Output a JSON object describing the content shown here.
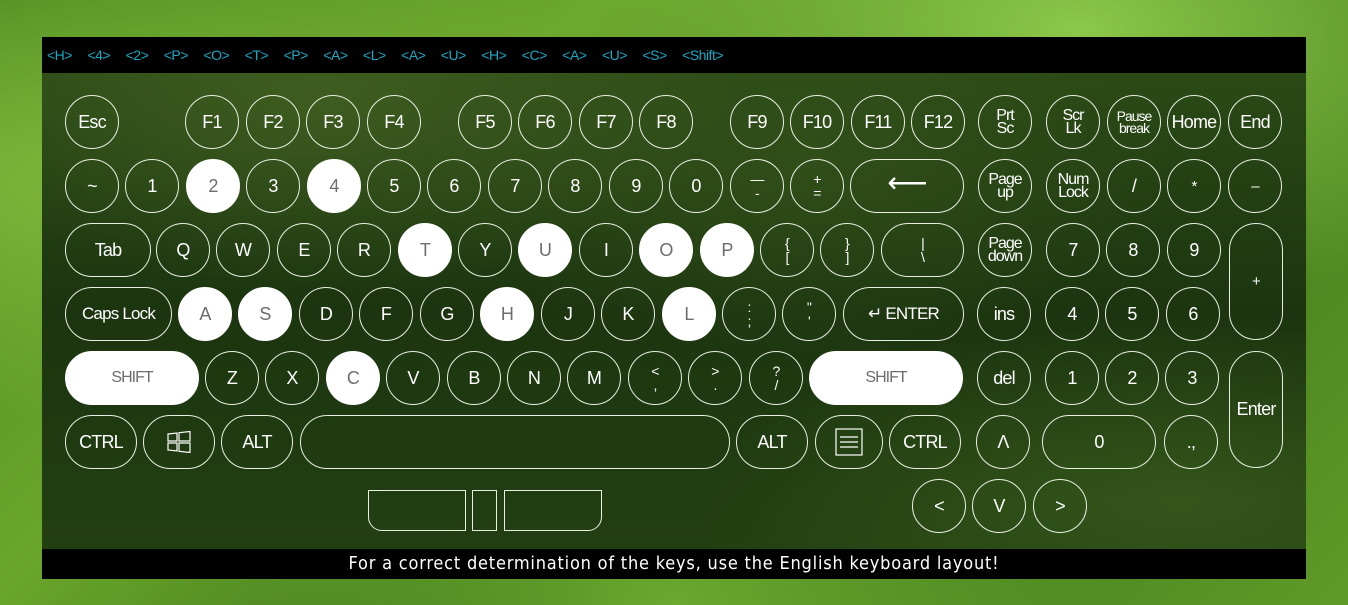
{
  "sequence": [
    "<H>",
    "<4>",
    "<2>",
    "<P>",
    "<O>",
    "<T>",
    "<P>",
    "<A>",
    "<L>",
    "<A>",
    "<U>",
    "<H>",
    "<C>",
    "<A>",
    "<U>",
    "<S>",
    "<Shift>"
  ],
  "footer_message": "For a correct determination of the keys, use the English keyboard layout!",
  "highlight_color": "#ffffff",
  "sequence_color": "#19a9c4",
  "keys": {
    "esc": "Esc",
    "f1": "F1",
    "f2": "F2",
    "f3": "F3",
    "f4": "F4",
    "f5": "F5",
    "f6": "F6",
    "f7": "F7",
    "f8": "F8",
    "f9": "F9",
    "f10": "F10",
    "f11": "F11",
    "f12": "F12",
    "prtsc": [
      "Prt",
      "Sc"
    ],
    "scrlk": [
      "Scr",
      "Lk"
    ],
    "pause": [
      "Pause",
      "break"
    ],
    "home": "Home",
    "end": "End",
    "tilde": "~",
    "k1": "1",
    "k2": "2",
    "k3": "3",
    "k4": "4",
    "k5": "5",
    "k6": "6",
    "k7": "7",
    "k8": "8",
    "k9": "9",
    "k0": "0",
    "minus": [
      "—",
      "-"
    ],
    "plus": [
      "+",
      "="
    ],
    "backspace": "⟵",
    "pageup": [
      "Page",
      "up"
    ],
    "numlock": [
      "Num",
      "Lock"
    ],
    "np_div": "/",
    "np_mul": "*",
    "np_sub": "–",
    "tab": "Tab",
    "q": "Q",
    "w": "W",
    "e": "E",
    "r": "R",
    "t": "T",
    "y": "Y",
    "u": "U",
    "i": "I",
    "o": "O",
    "p": "P",
    "lbrace": [
      "{",
      "["
    ],
    "rbrace": [
      "}",
      "]"
    ],
    "backslash": [
      "|",
      "\\"
    ],
    "pagedown": [
      "Page",
      "down"
    ],
    "np7": "7",
    "np8": "8",
    "np9": "9",
    "np_add": "+",
    "caps": "Caps Lock",
    "a": "A",
    "s": "S",
    "d": "D",
    "f": "F",
    "g": "G",
    "h": "H",
    "j": "J",
    "k": "K",
    "l": "L",
    "semicolon": [
      ":",
      ";"
    ],
    "quote": [
      "\"",
      "'"
    ],
    "enter": "↵ ENTER",
    "ins": "ins",
    "np4": "4",
    "np5": "5",
    "np6": "6",
    "lshift": "SHIFT",
    "z": "Z",
    "x": "X",
    "c": "C",
    "v": "V",
    "b": "B",
    "n": "N",
    "m": "M",
    "comma": [
      "<",
      ","
    ],
    "period": [
      ">",
      "."
    ],
    "slash": [
      "?",
      "/"
    ],
    "rshift": "SHIFT",
    "del": "del",
    "np1": "1",
    "np2": "2",
    "np3": "3",
    "np_enter": "Enter",
    "lctrl": "CTRL",
    "win": "windows",
    "lalt": "ALT",
    "space": "",
    "ralt": "ALT",
    "menu": "menu",
    "rctrl": "CTRL",
    "up": "Λ",
    "np0": "0",
    "np_dec": ".,",
    "left": "<",
    "down": "V",
    "right": ">"
  },
  "pressed_keys": [
    "k2",
    "k4",
    "t",
    "u",
    "o",
    "p",
    "a",
    "s",
    "h",
    "l",
    "lshift",
    "c",
    "rshift"
  ]
}
